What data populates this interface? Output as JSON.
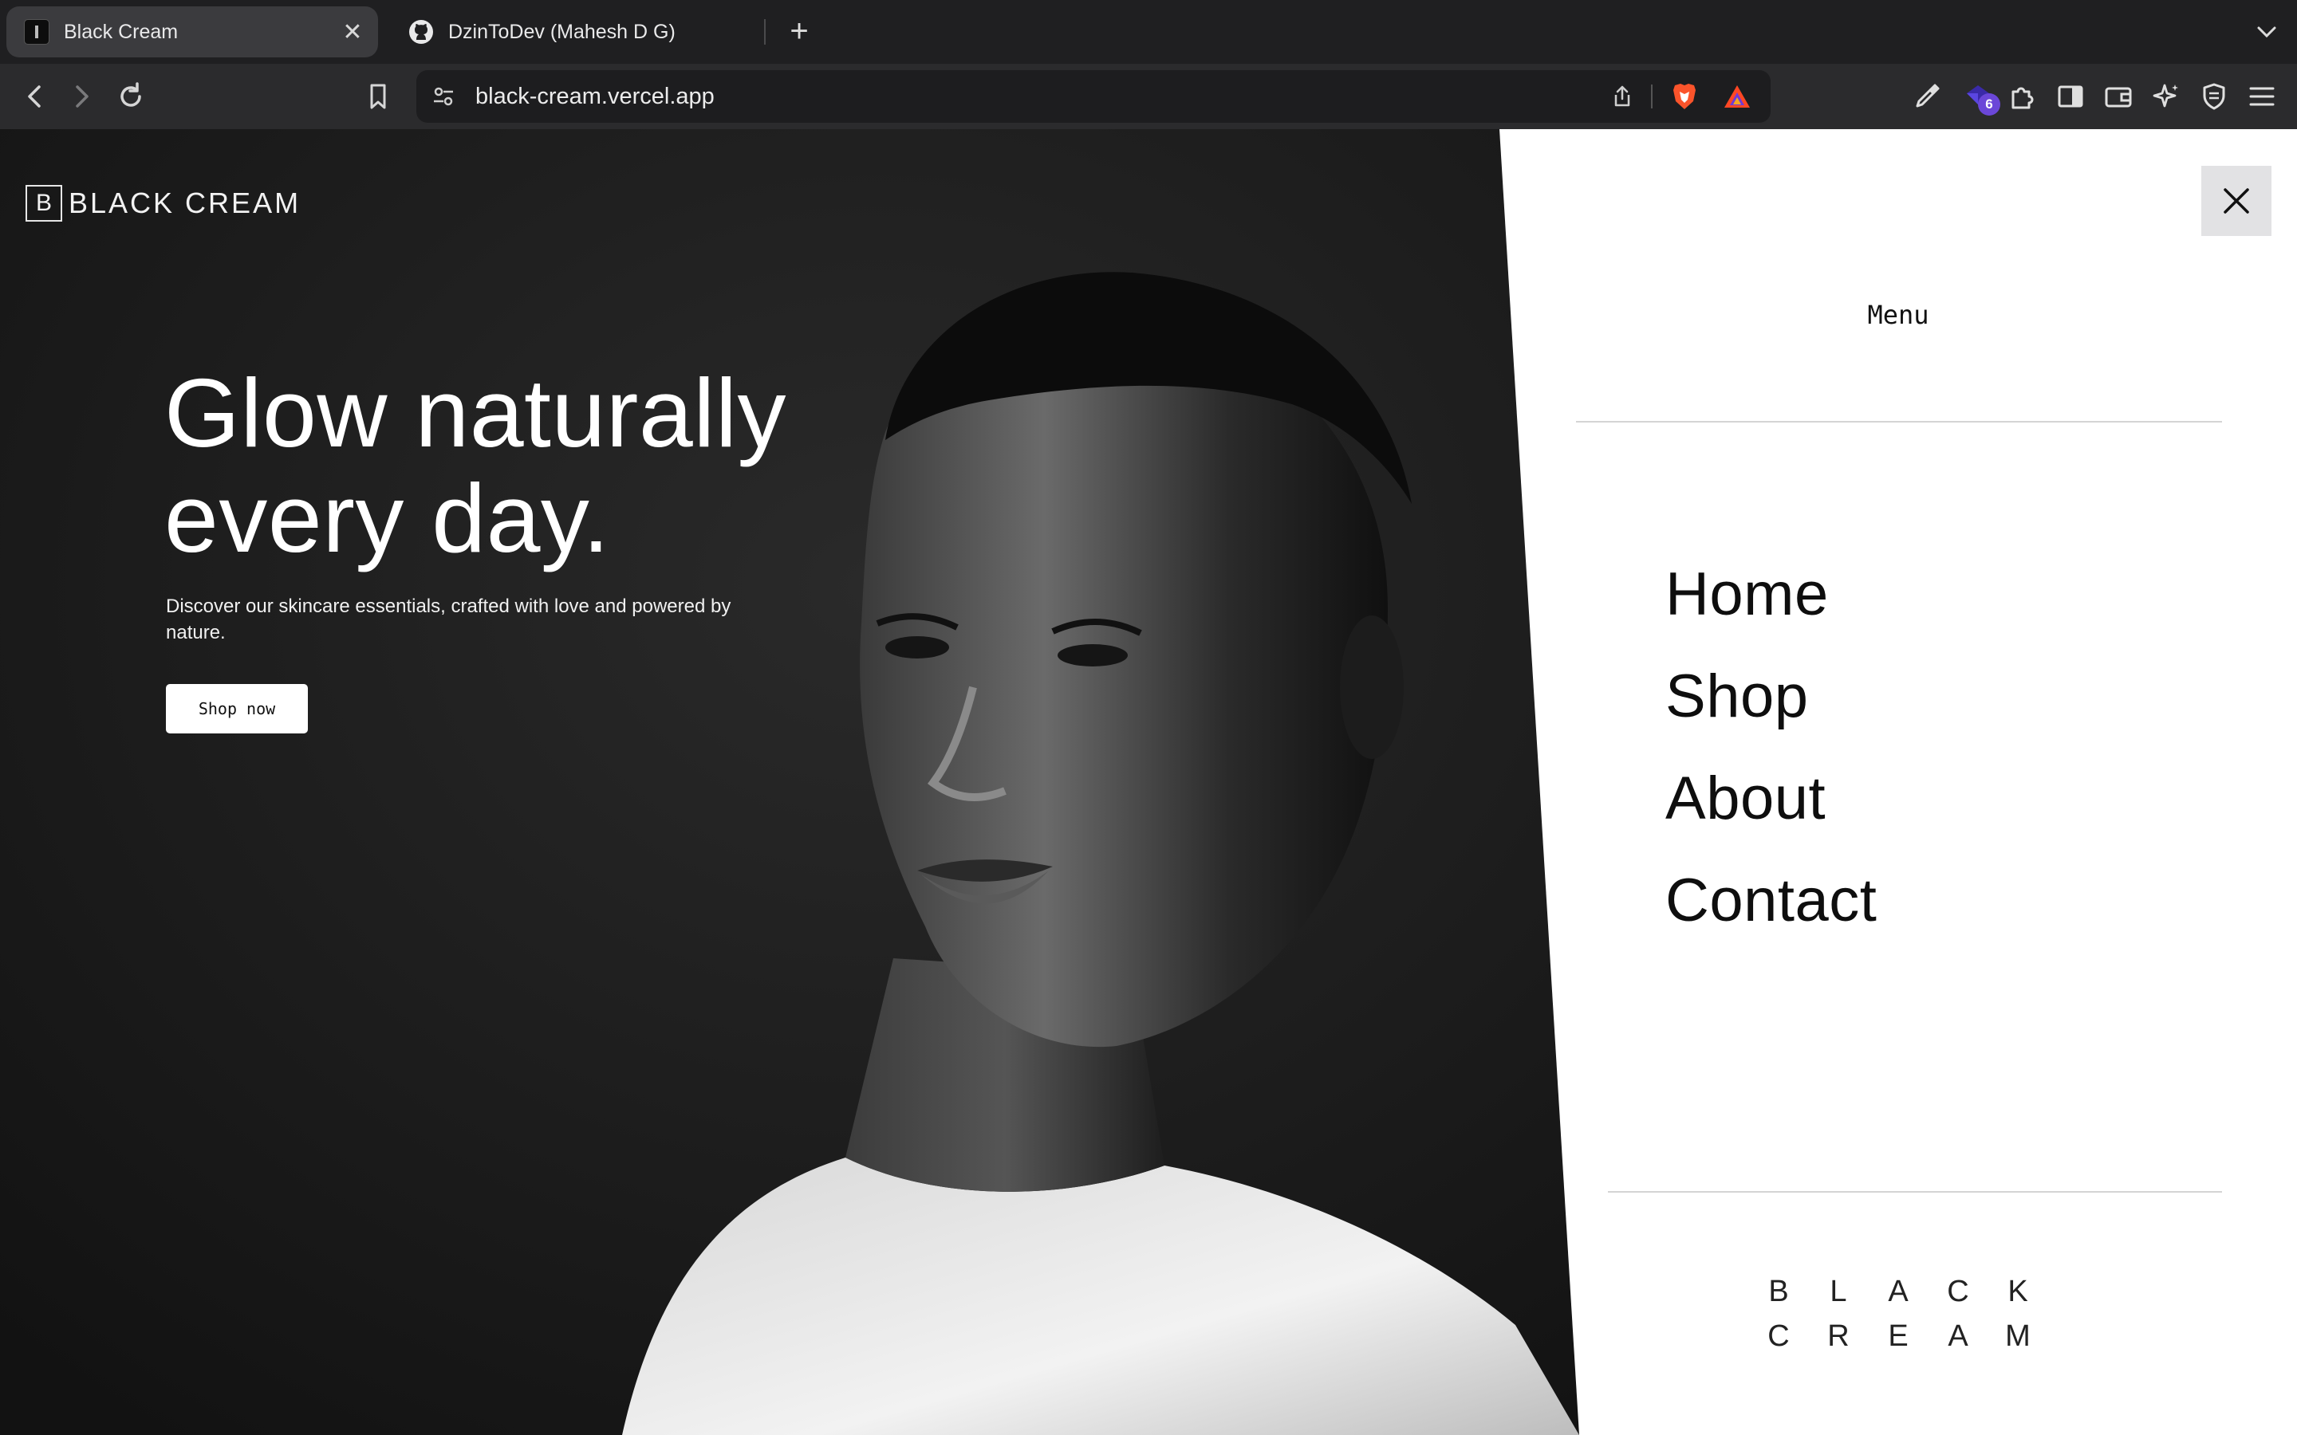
{
  "browser": {
    "tabs": [
      {
        "title": "Black Cream",
        "active": true
      },
      {
        "title": "DzinToDev (Mahesh D G)",
        "active": false
      }
    ],
    "url": "black-cream.vercel.app",
    "extension_badge": "6"
  },
  "site": {
    "logo_letter": "B",
    "logo_text": "BLACK CREAM",
    "hero_title_line1": "Glow naturally",
    "hero_title_line2": "every day.",
    "hero_subtitle": "Discover our skincare essentials, crafted with love and powered by nature.",
    "hero_button": "Shop now"
  },
  "menu": {
    "label": "Menu",
    "items": [
      "Home",
      "Shop",
      "About",
      "Contact"
    ],
    "wordmark_row1": [
      "B",
      "L",
      "A",
      "C",
      "K"
    ],
    "wordmark_row2": [
      "C",
      "R",
      "E",
      "A",
      "M"
    ]
  },
  "colors": {
    "page_background": "#141414",
    "menu_background": "#ffffff",
    "close_button_bg": "#e2e2e4",
    "brave_accent": "#fb542b"
  }
}
